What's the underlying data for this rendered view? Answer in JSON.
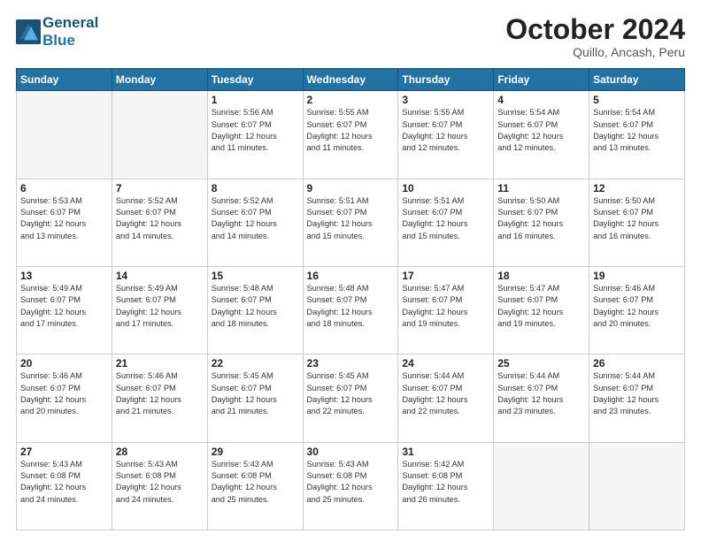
{
  "header": {
    "logo_line1": "General",
    "logo_line2": "Blue",
    "month": "October 2024",
    "location": "Quillo, Ancash, Peru"
  },
  "days": [
    "Sunday",
    "Monday",
    "Tuesday",
    "Wednesday",
    "Thursday",
    "Friday",
    "Saturday"
  ],
  "weeks": [
    [
      {
        "day": "",
        "info": ""
      },
      {
        "day": "",
        "info": ""
      },
      {
        "day": "1",
        "info": "Sunrise: 5:56 AM\nSunset: 6:07 PM\nDaylight: 12 hours\nand 11 minutes."
      },
      {
        "day": "2",
        "info": "Sunrise: 5:55 AM\nSunset: 6:07 PM\nDaylight: 12 hours\nand 11 minutes."
      },
      {
        "day": "3",
        "info": "Sunrise: 5:55 AM\nSunset: 6:07 PM\nDaylight: 12 hours\nand 12 minutes."
      },
      {
        "day": "4",
        "info": "Sunrise: 5:54 AM\nSunset: 6:07 PM\nDaylight: 12 hours\nand 12 minutes."
      },
      {
        "day": "5",
        "info": "Sunrise: 5:54 AM\nSunset: 6:07 PM\nDaylight: 12 hours\nand 13 minutes."
      }
    ],
    [
      {
        "day": "6",
        "info": "Sunrise: 5:53 AM\nSunset: 6:07 PM\nDaylight: 12 hours\nand 13 minutes."
      },
      {
        "day": "7",
        "info": "Sunrise: 5:52 AM\nSunset: 6:07 PM\nDaylight: 12 hours\nand 14 minutes."
      },
      {
        "day": "8",
        "info": "Sunrise: 5:52 AM\nSunset: 6:07 PM\nDaylight: 12 hours\nand 14 minutes."
      },
      {
        "day": "9",
        "info": "Sunrise: 5:51 AM\nSunset: 6:07 PM\nDaylight: 12 hours\nand 15 minutes."
      },
      {
        "day": "10",
        "info": "Sunrise: 5:51 AM\nSunset: 6:07 PM\nDaylight: 12 hours\nand 15 minutes."
      },
      {
        "day": "11",
        "info": "Sunrise: 5:50 AM\nSunset: 6:07 PM\nDaylight: 12 hours\nand 16 minutes."
      },
      {
        "day": "12",
        "info": "Sunrise: 5:50 AM\nSunset: 6:07 PM\nDaylight: 12 hours\nand 16 minutes."
      }
    ],
    [
      {
        "day": "13",
        "info": "Sunrise: 5:49 AM\nSunset: 6:07 PM\nDaylight: 12 hours\nand 17 minutes."
      },
      {
        "day": "14",
        "info": "Sunrise: 5:49 AM\nSunset: 6:07 PM\nDaylight: 12 hours\nand 17 minutes."
      },
      {
        "day": "15",
        "info": "Sunrise: 5:48 AM\nSunset: 6:07 PM\nDaylight: 12 hours\nand 18 minutes."
      },
      {
        "day": "16",
        "info": "Sunrise: 5:48 AM\nSunset: 6:07 PM\nDaylight: 12 hours\nand 18 minutes."
      },
      {
        "day": "17",
        "info": "Sunrise: 5:47 AM\nSunset: 6:07 PM\nDaylight: 12 hours\nand 19 minutes."
      },
      {
        "day": "18",
        "info": "Sunrise: 5:47 AM\nSunset: 6:07 PM\nDaylight: 12 hours\nand 19 minutes."
      },
      {
        "day": "19",
        "info": "Sunrise: 5:46 AM\nSunset: 6:07 PM\nDaylight: 12 hours\nand 20 minutes."
      }
    ],
    [
      {
        "day": "20",
        "info": "Sunrise: 5:46 AM\nSunset: 6:07 PM\nDaylight: 12 hours\nand 20 minutes."
      },
      {
        "day": "21",
        "info": "Sunrise: 5:46 AM\nSunset: 6:07 PM\nDaylight: 12 hours\nand 21 minutes."
      },
      {
        "day": "22",
        "info": "Sunrise: 5:45 AM\nSunset: 6:07 PM\nDaylight: 12 hours\nand 21 minutes."
      },
      {
        "day": "23",
        "info": "Sunrise: 5:45 AM\nSunset: 6:07 PM\nDaylight: 12 hours\nand 22 minutes."
      },
      {
        "day": "24",
        "info": "Sunrise: 5:44 AM\nSunset: 6:07 PM\nDaylight: 12 hours\nand 22 minutes."
      },
      {
        "day": "25",
        "info": "Sunrise: 5:44 AM\nSunset: 6:07 PM\nDaylight: 12 hours\nand 23 minutes."
      },
      {
        "day": "26",
        "info": "Sunrise: 5:44 AM\nSunset: 6:07 PM\nDaylight: 12 hours\nand 23 minutes."
      }
    ],
    [
      {
        "day": "27",
        "info": "Sunrise: 5:43 AM\nSunset: 6:08 PM\nDaylight: 12 hours\nand 24 minutes."
      },
      {
        "day": "28",
        "info": "Sunrise: 5:43 AM\nSunset: 6:08 PM\nDaylight: 12 hours\nand 24 minutes."
      },
      {
        "day": "29",
        "info": "Sunrise: 5:43 AM\nSunset: 6:08 PM\nDaylight: 12 hours\nand 25 minutes."
      },
      {
        "day": "30",
        "info": "Sunrise: 5:43 AM\nSunset: 6:08 PM\nDaylight: 12 hours\nand 25 minutes."
      },
      {
        "day": "31",
        "info": "Sunrise: 5:42 AM\nSunset: 6:08 PM\nDaylight: 12 hours\nand 26 minutes."
      },
      {
        "day": "",
        "info": ""
      },
      {
        "day": "",
        "info": ""
      }
    ]
  ]
}
